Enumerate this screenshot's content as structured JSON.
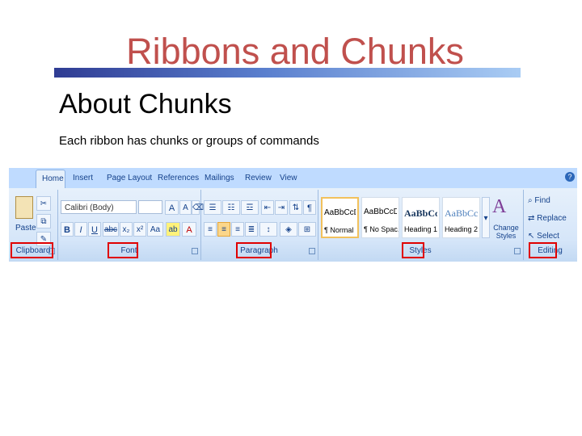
{
  "slide": {
    "title": "Ribbons and Chunks",
    "heading": "About Chunks",
    "body": "Each ribbon has chunks or groups of commands"
  },
  "colors": {
    "title": "#c0504d",
    "highlight": "#e00000",
    "ribbon_text": "#15428b"
  },
  "ribbon": {
    "tabs": [
      "Home",
      "Insert",
      "Page Layout",
      "References",
      "Mailings",
      "Review",
      "View"
    ],
    "active_tab": "Home",
    "help": "?",
    "clipboard": {
      "label": "Clipboard",
      "paste": "Paste"
    },
    "font": {
      "label": "Font",
      "font_name": "Calibri (Body)",
      "font_size": "",
      "bold": "B",
      "italic": "I",
      "underline": "U",
      "strike": "abc",
      "subscript": "x₂",
      "superscript": "x²",
      "change_case": "Aa",
      "grow": "A",
      "shrink": "A",
      "color": "A"
    },
    "paragraph": {
      "label": "Paragraph",
      "pilcrow": "¶"
    },
    "styles": {
      "label": "Styles",
      "items": [
        {
          "sample": "AaBbCcDc",
          "name": "¶ Normal"
        },
        {
          "sample": "AaBbCcDc",
          "name": "¶ No Spac..."
        },
        {
          "sample": "AaBbCc",
          "name": "Heading 1"
        },
        {
          "sample": "AaBbCc",
          "name": "Heading 2"
        }
      ],
      "change_styles": "Change Styles"
    },
    "editing": {
      "label": "Editing",
      "find": "Find",
      "replace": "Replace",
      "select": "Select"
    }
  }
}
